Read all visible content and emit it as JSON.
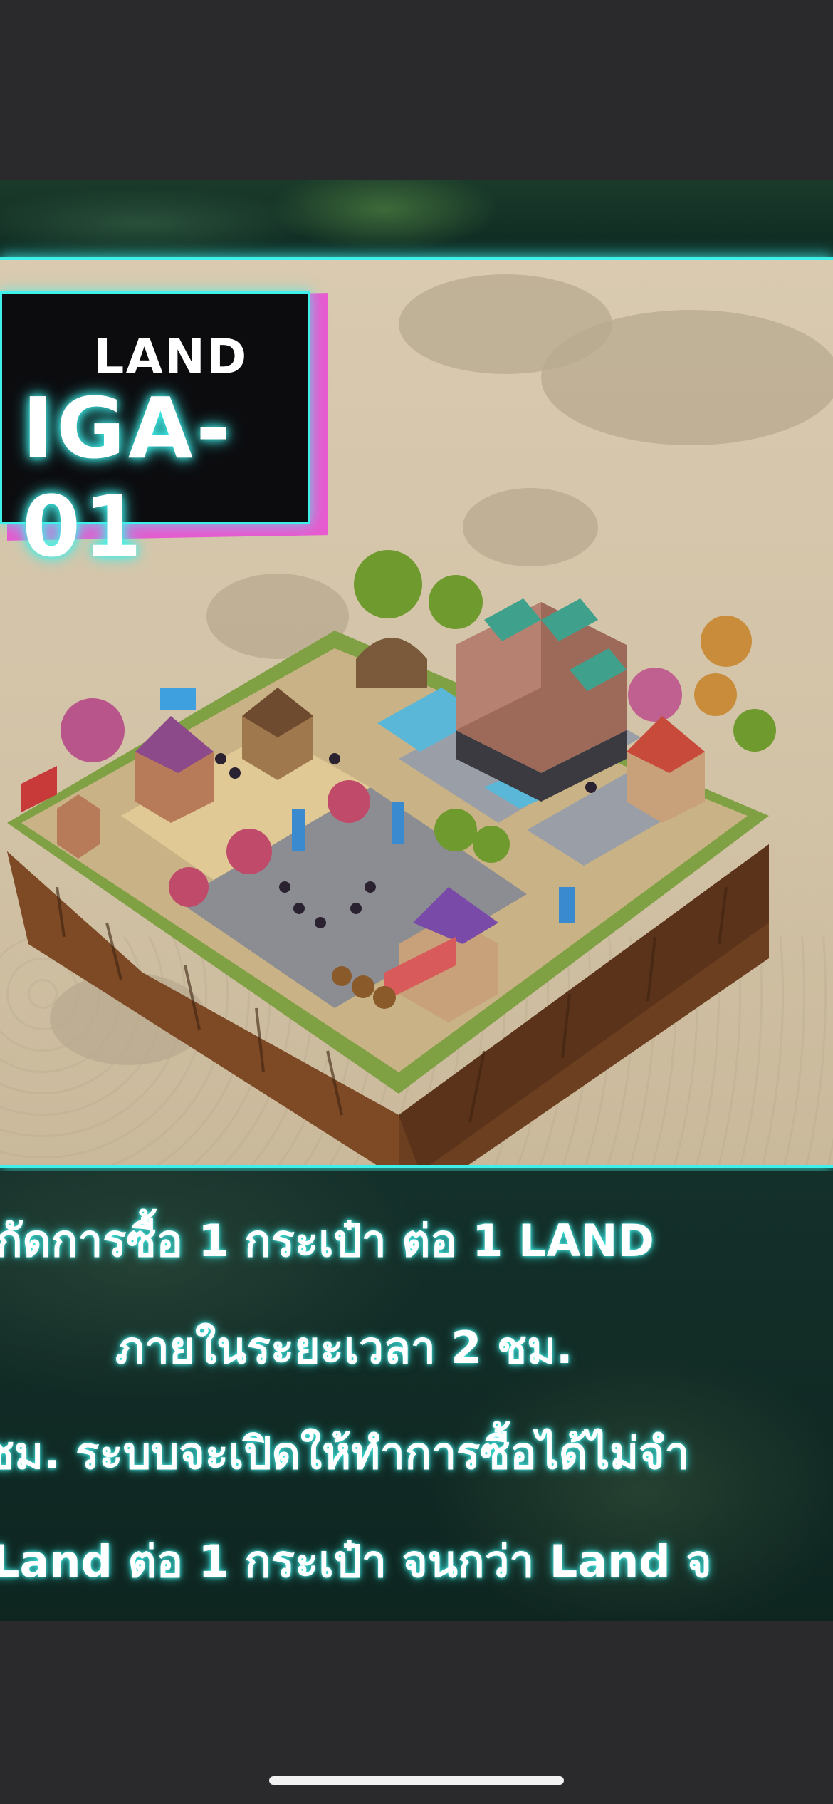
{
  "title_card": {
    "line1": "LAND",
    "line2": "IGA-01"
  },
  "caption": {
    "line1": "กัดการซื้อ 1 กระเป๋า ต่อ 1 LAND",
    "line2": "ภายในระยะเวลา 2 ชม.",
    "line3": " ชม. ระบบจะเปิดให้ทำการซื้อได้ไม่จำ",
    "line4": "Land ต่อ 1 กระเป๋า จนกว่า Land จ"
  },
  "colors": {
    "neon_cyan": "#3ff0ea",
    "pink": "#e85ad0",
    "parchment": "#d9cab0",
    "dark_bg": "#2a2a2c"
  }
}
